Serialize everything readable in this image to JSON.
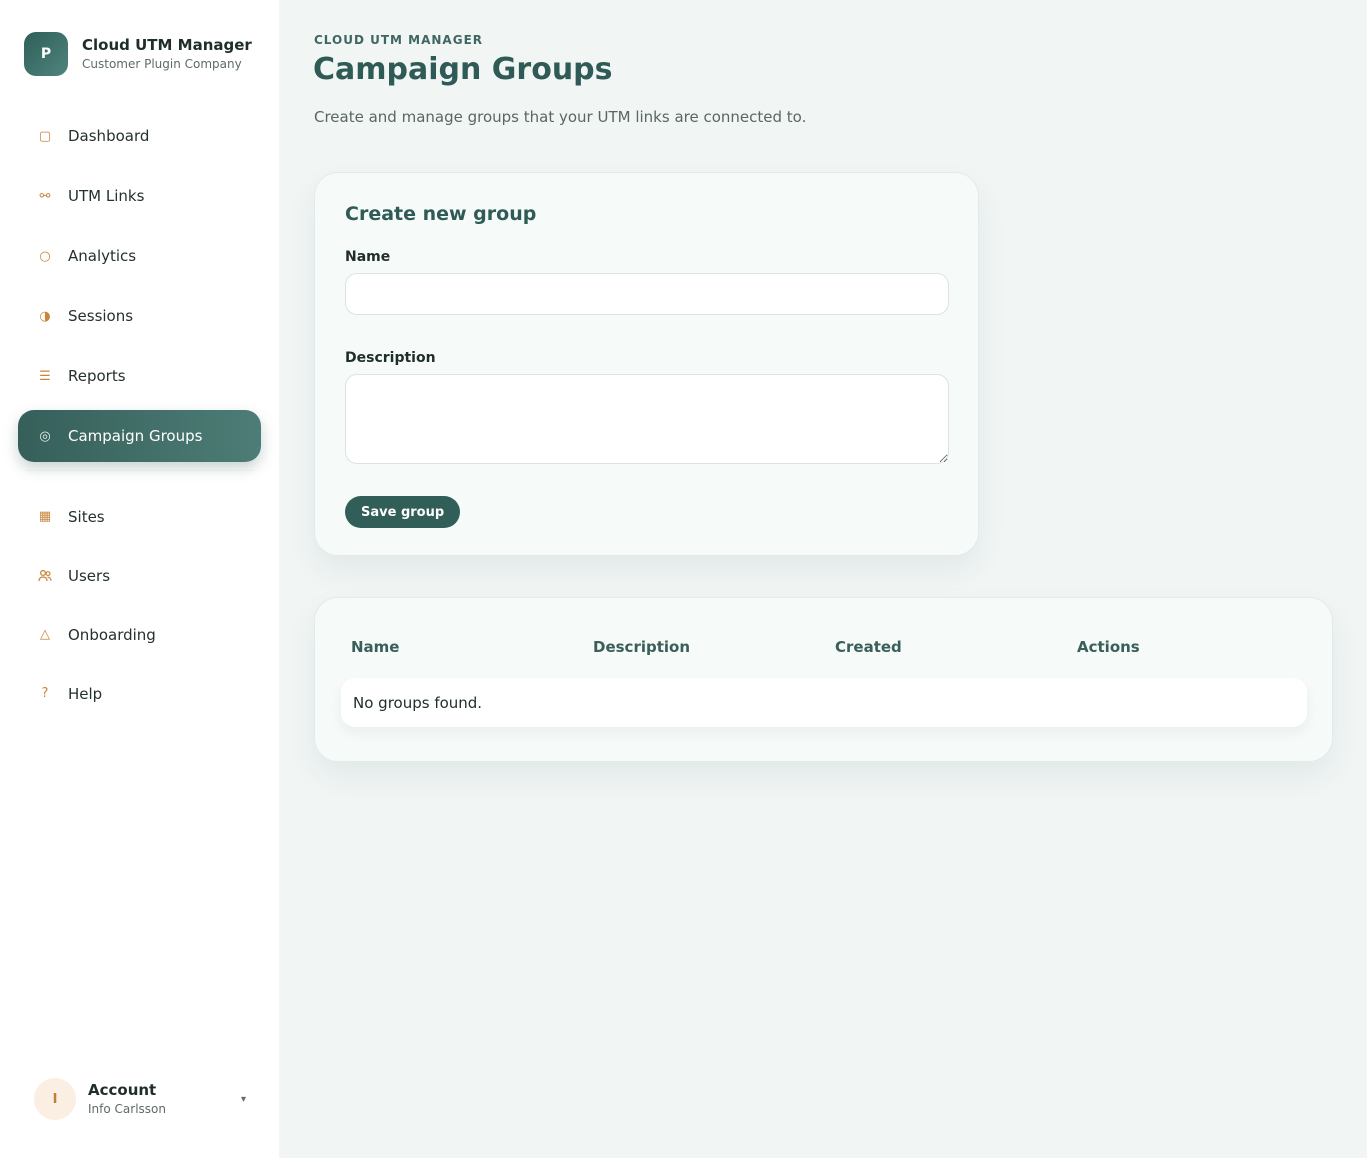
{
  "brand": {
    "logo_letter": "P",
    "title": "Cloud UTM Manager",
    "subtitle": "Customer Plugin Company"
  },
  "nav": {
    "primary": [
      {
        "label": "Dashboard",
        "icon": "square-icon",
        "glyph": "▢"
      },
      {
        "label": "UTM Links",
        "icon": "link-icon",
        "glyph": "⚯"
      },
      {
        "label": "Analytics",
        "icon": "circle-icon",
        "glyph": "○"
      },
      {
        "label": "Sessions",
        "icon": "half-circle-icon",
        "glyph": "◑"
      },
      {
        "label": "Reports",
        "icon": "lines-icon",
        "glyph": "☰"
      },
      {
        "label": "Campaign Groups",
        "icon": "target-icon",
        "glyph": "◎",
        "active": true
      }
    ],
    "secondary": [
      {
        "label": "Sites",
        "icon": "grid-icon",
        "glyph": "▦"
      },
      {
        "label": "Users",
        "icon": "users-icon",
        "glyph": "👥"
      },
      {
        "label": "Onboarding",
        "icon": "triangle-icon",
        "glyph": "△"
      },
      {
        "label": "Help",
        "icon": "question-icon",
        "glyph": "?"
      }
    ]
  },
  "account": {
    "initial": "I",
    "title": "Account",
    "name": "Info Carlsson",
    "caret": "▾"
  },
  "header": {
    "eyebrow": "CLOUD UTM MANAGER",
    "title": "Campaign Groups",
    "description": "Create and manage groups that your UTM links are connected to."
  },
  "form": {
    "title": "Create new group",
    "name_label": "Name",
    "name_value": "",
    "description_label": "Description",
    "description_value": "",
    "save_label": "Save group"
  },
  "table": {
    "columns": [
      "Name",
      "Description",
      "Created",
      "Actions"
    ],
    "empty_text": "No groups found."
  },
  "colors": {
    "accent": "#315e58",
    "icon_accent": "#c9853c",
    "background": "#f1f6f5"
  }
}
